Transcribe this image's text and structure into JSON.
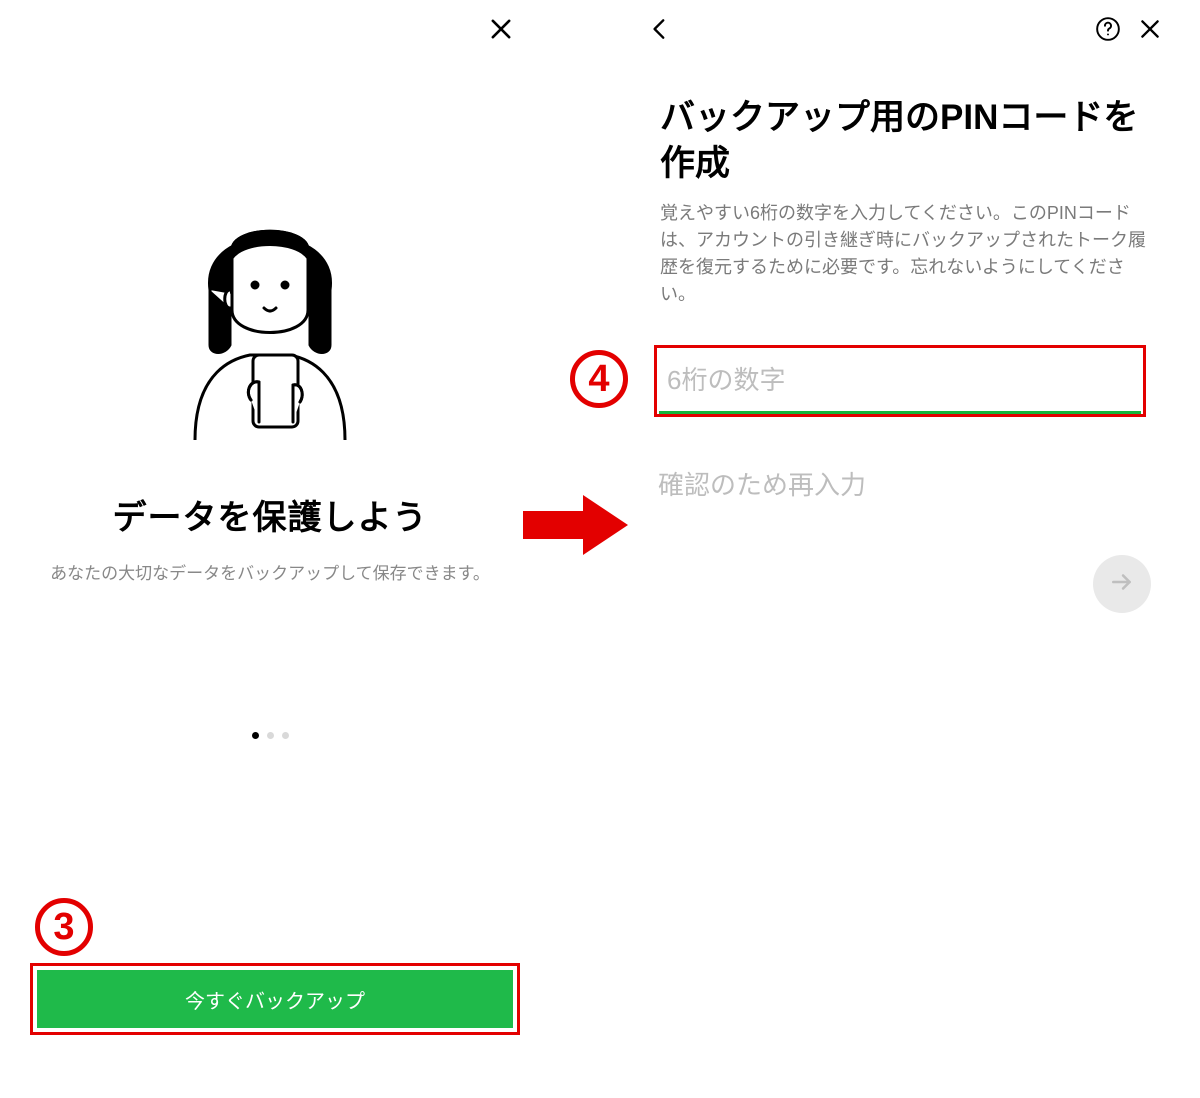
{
  "left_screen": {
    "title": "データを保護しよう",
    "subtitle": "あなたの大切なデータをバックアップして保存できます。",
    "backup_button_label": "今すぐバックアップ",
    "pager_dots_total": 3,
    "pager_active_index": 0
  },
  "right_screen": {
    "title": "バックアップ用のPINコードを作成",
    "description": "覚えやすい6桁の数字を入力してください。このPINコードは、アカウントの引き継ぎ時にバックアップされたトーク履歴を復元するために必要です。忘れないようにしてください。",
    "pin_placeholder": "6桁の数字",
    "confirm_placeholder": "確認のため再入力"
  },
  "callouts": {
    "step3": "3",
    "step4": "4"
  },
  "colors": {
    "callout_red": "#e30000",
    "primary_green": "#1fba4a",
    "underline_green": "#14b53b"
  }
}
